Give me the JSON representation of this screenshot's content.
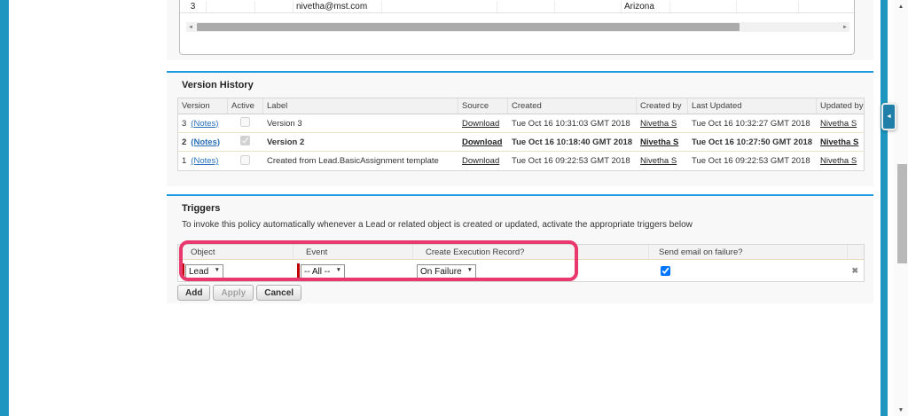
{
  "colors": {
    "accent_teal": "#1e96c0",
    "section_border_blue": "#1e9be0",
    "annotation_pink": "#e8386d",
    "link_blue": "#2a70b8",
    "required_red": "#c00000"
  },
  "icons": {
    "collapse_arrow": "◄",
    "scroll_up": "▲",
    "scroll_down": "▼",
    "scroll_left": "◄",
    "scroll_right": "►",
    "dropdown_arrow": "▼",
    "delete_x": "✖"
  },
  "top_table": {
    "row_number": "3",
    "email": "nivetha@mst.com",
    "state": "Arizona"
  },
  "version_history": {
    "title": "Version History",
    "columns": [
      "Version",
      "Active",
      "Label",
      "Source",
      "Created",
      "Created by",
      "Last Updated",
      "Updated by"
    ],
    "notes_label": "(Notes)",
    "rows": [
      {
        "version": "3",
        "active": false,
        "label": "Version 3",
        "source": "Download",
        "created": "Tue Oct 16 10:31:03 GMT 2018",
        "created_by": "Nivetha S",
        "last_updated": "Tue Oct 16 10:32:27 GMT 2018",
        "updated_by": "Nivetha S"
      },
      {
        "version": "2",
        "active": true,
        "label": "Version 2",
        "source": "Download",
        "created": "Tue Oct 16 10:18:40 GMT 2018",
        "created_by": "Nivetha S",
        "last_updated": "Tue Oct 16 10:27:50 GMT 2018",
        "updated_by": "Nivetha S"
      },
      {
        "version": "1",
        "active": false,
        "label": "Created from Lead.BasicAssignment template",
        "source": "Download",
        "created": "Tue Oct 16 09:22:53 GMT 2018",
        "created_by": "Nivetha S",
        "last_updated": "Tue Oct 16 09:22:53 GMT 2018",
        "updated_by": "Nivetha S"
      }
    ]
  },
  "triggers": {
    "title": "Triggers",
    "description": "To invoke this policy automatically whenever a Lead or related object is created or updated, activate the appropriate triggers below",
    "columns": {
      "object": "Object",
      "event": "Event",
      "execution": "Create Execution Record?",
      "send_email": "Send email on failure?"
    },
    "row": {
      "object": "Lead",
      "event": "-- All --",
      "execution_record": "On Failure",
      "send_email": true
    },
    "buttons": {
      "add": "Add",
      "apply": "Apply",
      "cancel": "Cancel"
    }
  }
}
